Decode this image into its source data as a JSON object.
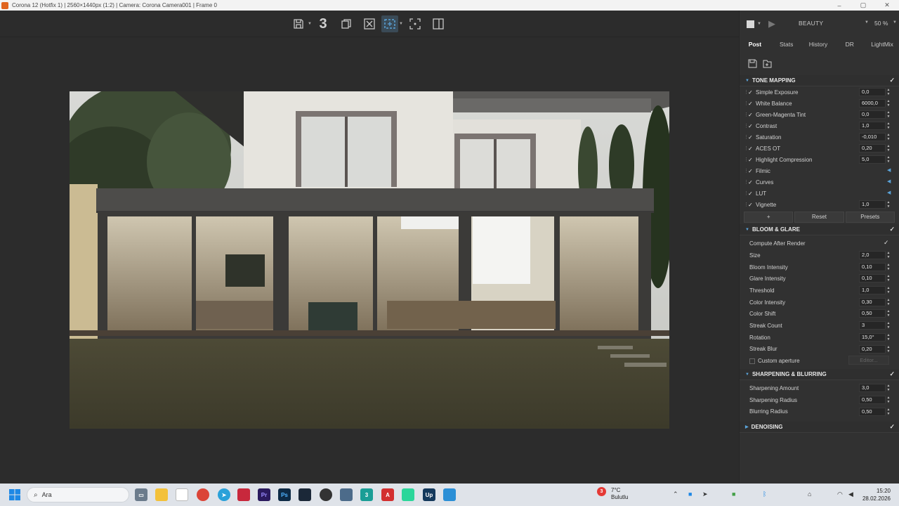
{
  "window": {
    "title": "Corona 12 (Hotfix 1) | 2560×1440px (1:2) | Camera: Corona Camera001 | Frame 0",
    "controls": [
      "–",
      "▢",
      "✕"
    ]
  },
  "toolbar": {
    "buttons": [
      "save-icon",
      "number-3-icon",
      "copy-icon",
      "clear-icon",
      "region-select-icon",
      "fit-icon",
      "split-icon"
    ],
    "three_label": "3"
  },
  "panel": {
    "pass_name": "BEAUTY",
    "zoom": "50 %",
    "tabs": [
      "Post",
      "Stats",
      "History",
      "DR",
      "LightMix"
    ],
    "active_tab": "Post",
    "tone_mapping": {
      "title": "TONE MAPPING",
      "rows": [
        {
          "label": "Simple Exposure",
          "value": "0,0"
        },
        {
          "label": "White Balance",
          "value": "6000,0"
        },
        {
          "label": "Green-Magenta Tint",
          "value": "0,0"
        },
        {
          "label": "Contrast",
          "value": "1,0"
        },
        {
          "label": "Saturation",
          "value": "-0,010"
        },
        {
          "label": "ACES OT",
          "value": "0,20"
        },
        {
          "label": "Highlight Compression",
          "value": "5,0"
        },
        {
          "label": "Filmic",
          "value": ""
        },
        {
          "label": "Curves",
          "value": ""
        },
        {
          "label": "LUT",
          "value": ""
        },
        {
          "label": "Vignette",
          "value": "1,0"
        }
      ],
      "buttons": [
        "+",
        "Reset",
        "Presets"
      ]
    },
    "bloom_glare": {
      "title": "BLOOM & GLARE",
      "compute_after_render": "Compute After Render",
      "rows": [
        {
          "label": "Size",
          "value": "2,0"
        },
        {
          "label": "Bloom Intensity",
          "value": "0,10"
        },
        {
          "label": "Glare Intensity",
          "value": "0,10"
        },
        {
          "label": "Threshold",
          "value": "1,0"
        },
        {
          "label": "Color Intensity",
          "value": "0,30"
        },
        {
          "label": "Color Shift",
          "value": "0,50"
        },
        {
          "label": "Streak Count",
          "value": "3"
        },
        {
          "label": "Rotation",
          "value": "15,0°"
        },
        {
          "label": "Streak Blur",
          "value": "0,20"
        }
      ],
      "custom_aperture": "Custom aperture",
      "editor": "Editor..."
    },
    "sharpening": {
      "title": "SHARPENING & BLURRING",
      "rows": [
        {
          "label": "Sharpening Amount",
          "value": "3,0"
        },
        {
          "label": "Sharpening Radius",
          "value": "0,50"
        },
        {
          "label": "Blurring Radius",
          "value": "0,50"
        }
      ]
    },
    "denoising": {
      "title": "DENOISING"
    }
  },
  "taskbar": {
    "search_placeholder": "Ara",
    "weather_temp": "7°C",
    "weather_desc": "Bulutlu",
    "weather_badge": "3",
    "time": "15:20",
    "date": "28.02.2026",
    "apps": [
      "start",
      "search",
      "taskview",
      "explorer",
      "notepad",
      "chrome",
      "telegram",
      "app-red",
      "premiere",
      "photoshop",
      "steam",
      "github",
      "calc",
      "3dsmax",
      "acrobat",
      "app-green",
      "upwork",
      "photos"
    ]
  },
  "colors": {
    "accent": "#5aa3d9",
    "panel_bg": "#313131",
    "viewport_bg": "#2c2c2c",
    "taskbar_bg": "#dfe3e9"
  }
}
